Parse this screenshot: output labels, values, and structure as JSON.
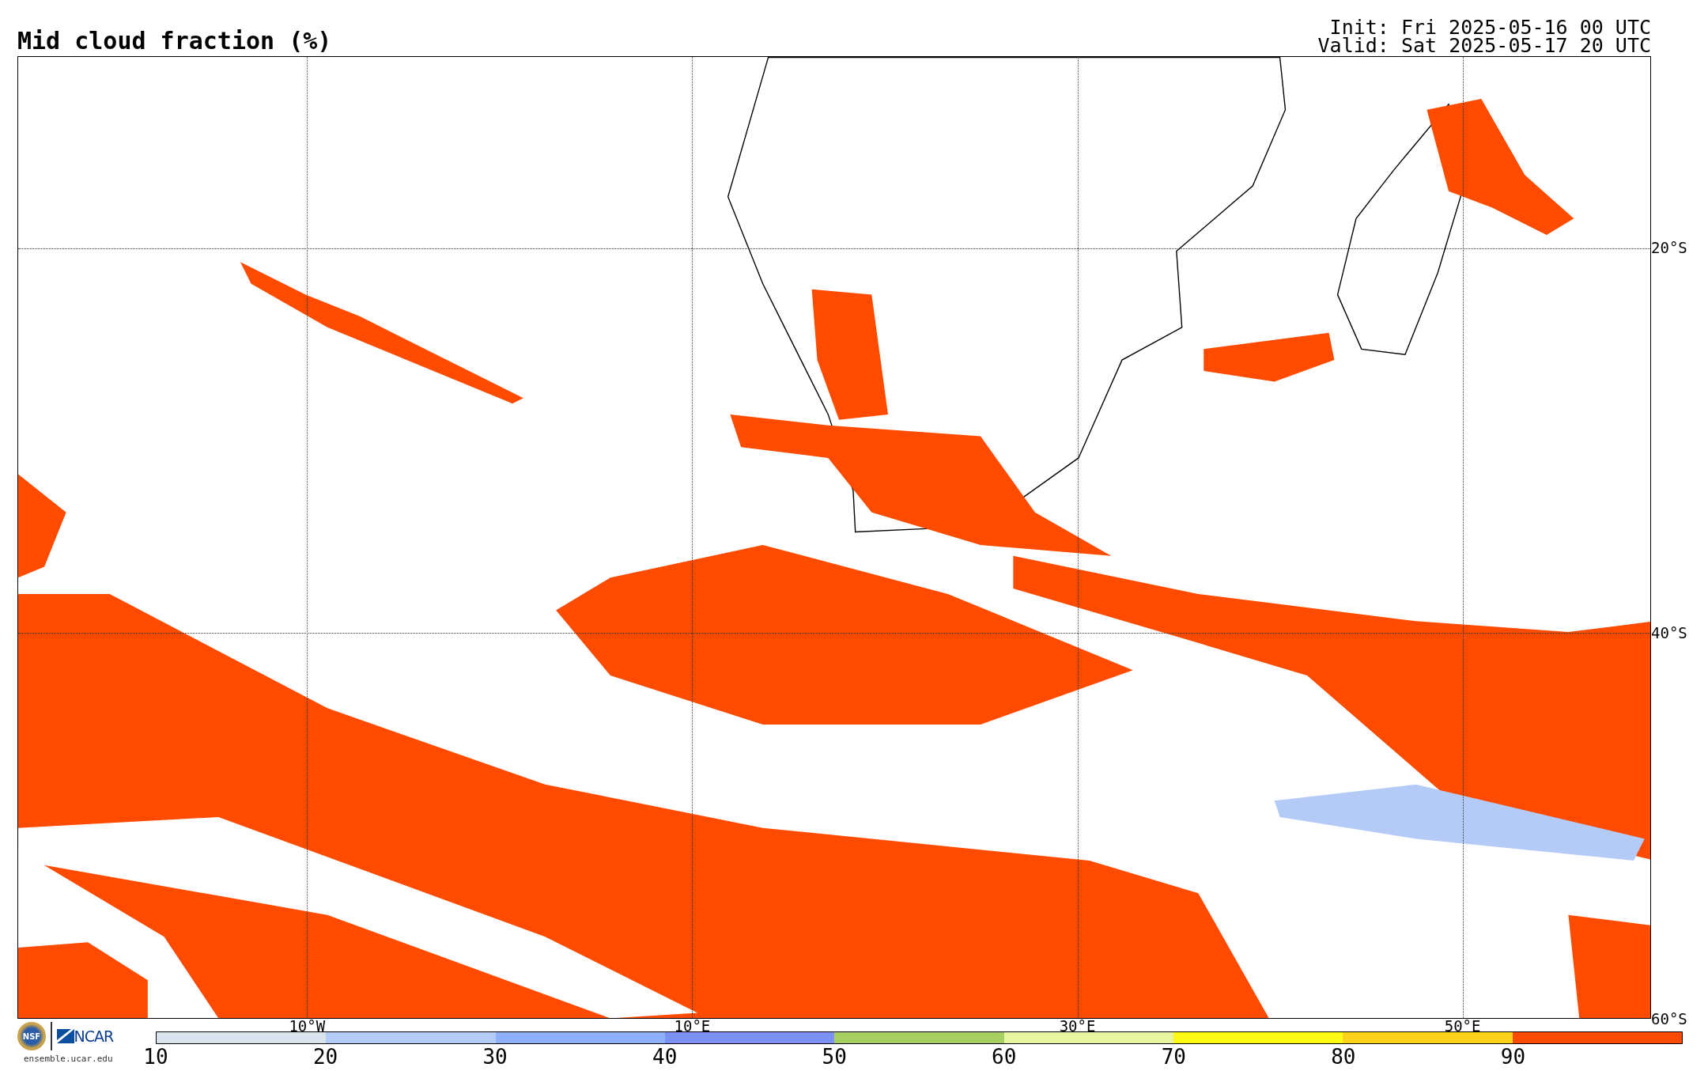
{
  "title": "Mid cloud fraction (%)",
  "run_info": [
    "Init: Fri 2025-05-16 00 UTC",
    "Valid: Sat 2025-05-17 20 UTC"
  ],
  "map": {
    "longitude_labels": [
      "10°W",
      "10°E",
      "30°E",
      "50°E"
    ],
    "latitude_labels": [
      "20°S",
      "40°S",
      "60°S"
    ]
  },
  "logos": {
    "nsf_text": "NSF",
    "org_text": "NCAR",
    "site": "ensemble.ucar.edu"
  },
  "colorbar": {
    "tick_labels": [
      "10",
      "20",
      "30",
      "40",
      "50",
      "60",
      "70",
      "80",
      "90"
    ],
    "bins": [
      {
        "color": "#d9e4ee"
      },
      {
        "color": "#b4cbf8"
      },
      {
        "color": "#8fb0fa"
      },
      {
        "color": "#7b91f5"
      },
      {
        "color": "#a8cf64"
      },
      {
        "color": "#e8f5a0"
      },
      {
        "color": "#fffa14"
      },
      {
        "color": "#ffd21e"
      },
      {
        "color": "#ff4b00"
      }
    ]
  }
}
